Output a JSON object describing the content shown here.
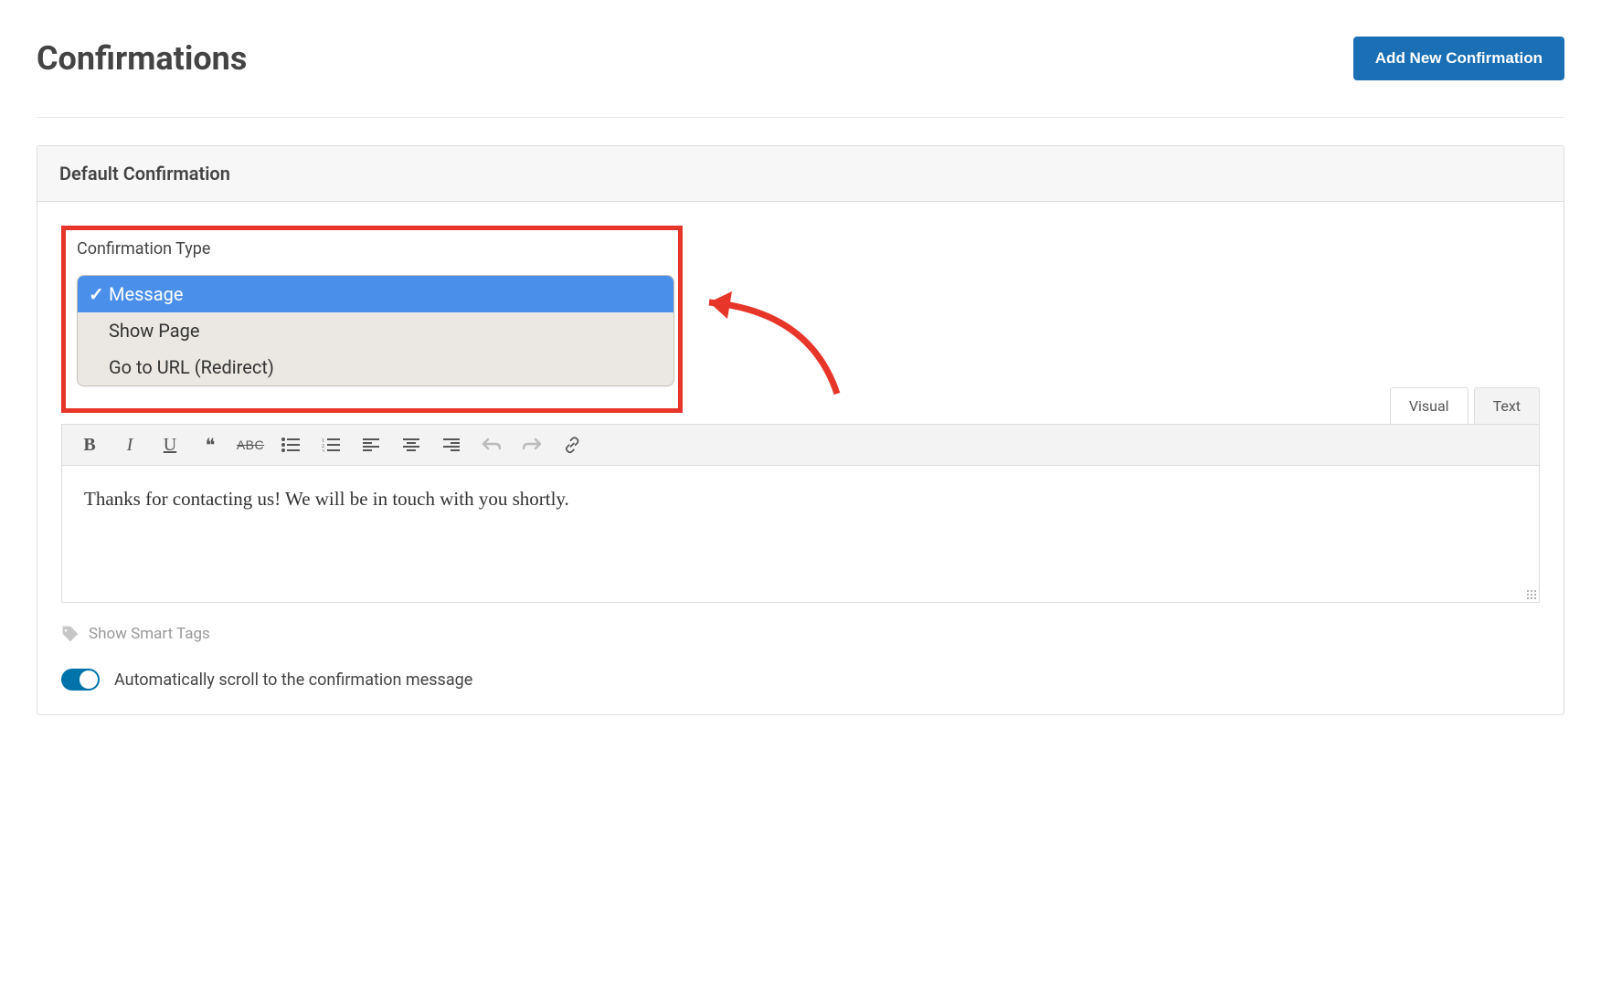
{
  "header": {
    "title": "Confirmations",
    "addButton": "Add New Confirmation"
  },
  "panel": {
    "title": "Default Confirmation",
    "typeLabel": "Confirmation Type",
    "options": {
      "message": "Message",
      "showPage": "Show Page",
      "redirect": "Go to URL (Redirect)"
    }
  },
  "editor": {
    "tabs": {
      "visual": "Visual",
      "text": "Text"
    },
    "content": "Thanks for contacting us! We will be in touch with you shortly.",
    "toolbar": {
      "bold": "B",
      "italic": "I",
      "underline": "U",
      "quote": "❝",
      "strike": "ABC"
    }
  },
  "smartTags": {
    "label": "Show Smart Tags"
  },
  "autoScroll": {
    "label": "Automatically scroll to the confirmation message"
  }
}
